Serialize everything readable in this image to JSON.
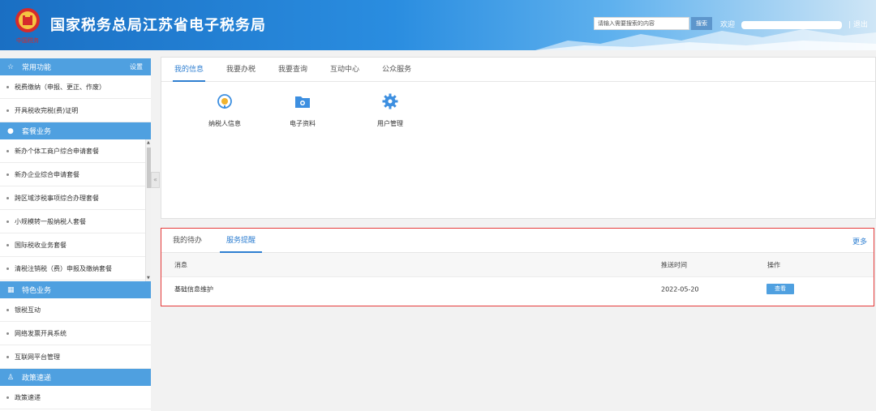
{
  "header": {
    "title": "国家税务总局江苏省电子税务局",
    "logo_text": "中国税务",
    "search_placeholder": "请输入需要搜索的内容",
    "search_button": "搜索",
    "welcome": "欢迎",
    "logout": "| 退出"
  },
  "sidebar": {
    "common": {
      "title": "常用功能",
      "settings": "设置",
      "items": [
        "税费缴纳（申报、更正、作废）",
        "开具税收完税(费)证明"
      ]
    },
    "packages": {
      "title": "套餐业务",
      "items": [
        "新办个体工商户综合申请套餐",
        "新办企业综合申请套餐",
        "跨区域涉税事项综合办理套餐",
        "小规模转一般纳税人套餐",
        "国际税收业务套餐",
        "清税注销税（费）申报及缴纳套餐"
      ]
    },
    "special": {
      "title": "特色业务",
      "items": [
        "银税互动",
        "网络发票开具系统",
        "互联网平台管理"
      ]
    },
    "policy": {
      "title": "政策速递",
      "items": [
        "政策速递"
      ]
    }
  },
  "main": {
    "tabs": [
      "我的信息",
      "我要办税",
      "我要查询",
      "互动中心",
      "公众服务"
    ],
    "tiles": [
      {
        "label": "纳税人信息",
        "icon": "taxpayer-info-icon"
      },
      {
        "label": "电子资料",
        "icon": "folder-icon"
      },
      {
        "label": "用户管理",
        "icon": "gear-icon"
      }
    ]
  },
  "service": {
    "tabs": [
      "我的待办",
      "服务提醒"
    ],
    "more": "更多",
    "columns": [
      "消息",
      "推送时间",
      "操作"
    ],
    "rows": [
      {
        "message": "基础信息维护",
        "time": "2022-05-20",
        "action": "查看"
      }
    ]
  },
  "colors": {
    "accent": "#2f7fd1",
    "sidebar_head": "#4fa0e0",
    "highlight_border": "#e53a3a"
  }
}
